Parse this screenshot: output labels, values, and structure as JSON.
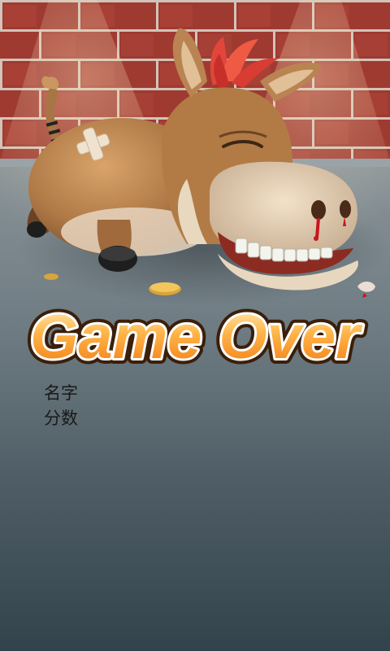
{
  "game_over": {
    "title_text": "Game Over",
    "name_label": "名字",
    "score_label": "分数"
  }
}
